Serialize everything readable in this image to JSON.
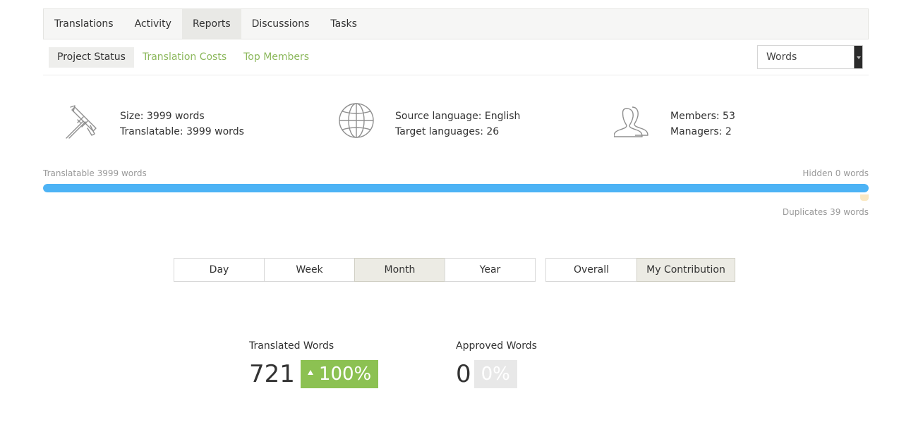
{
  "main_tabs": [
    {
      "label": "Translations",
      "active": false
    },
    {
      "label": "Activity",
      "active": false
    },
    {
      "label": "Reports",
      "active": true
    },
    {
      "label": "Discussions",
      "active": false
    },
    {
      "label": "Tasks",
      "active": false
    }
  ],
  "sub_tabs": [
    {
      "label": "Project Status",
      "active": true
    },
    {
      "label": "Translation Costs",
      "active": false
    },
    {
      "label": "Top Members",
      "active": false
    }
  ],
  "units_select": {
    "value": "Words"
  },
  "stats": {
    "size": {
      "icon": "caliper-icon",
      "line1": "Size: 3999 words",
      "line2": "Translatable: 3999 words"
    },
    "languages": {
      "icon": "globe-icon",
      "line1": "Source language: English",
      "line2": "Target languages: 26"
    },
    "members": {
      "icon": "users-icon",
      "line1": "Members: 53",
      "line2": "Managers: 2"
    }
  },
  "progress": {
    "translatable_label": "Translatable 3999 words",
    "hidden_label": "Hidden 0 words",
    "duplicates_label": "Duplicates 39 words",
    "translatable_fraction": 1.0,
    "color": "#4db3f5"
  },
  "period_buttons": [
    {
      "label": "Day",
      "active": false
    },
    {
      "label": "Week",
      "active": false
    },
    {
      "label": "Month",
      "active": true
    },
    {
      "label": "Year",
      "active": false
    }
  ],
  "scope_buttons": [
    {
      "label": "Overall",
      "active": false
    },
    {
      "label": "My Contribution",
      "active": true
    }
  ],
  "metrics": {
    "translated": {
      "label": "Translated Words",
      "value": "721",
      "change": "100%",
      "color": "#8cc152"
    },
    "approved": {
      "label": "Approved Words",
      "value": "0",
      "change": "0%",
      "color": "#e8e8e8"
    }
  },
  "colors": {
    "accent_green": "#8cb85c",
    "progress_blue": "#4db3f5"
  }
}
